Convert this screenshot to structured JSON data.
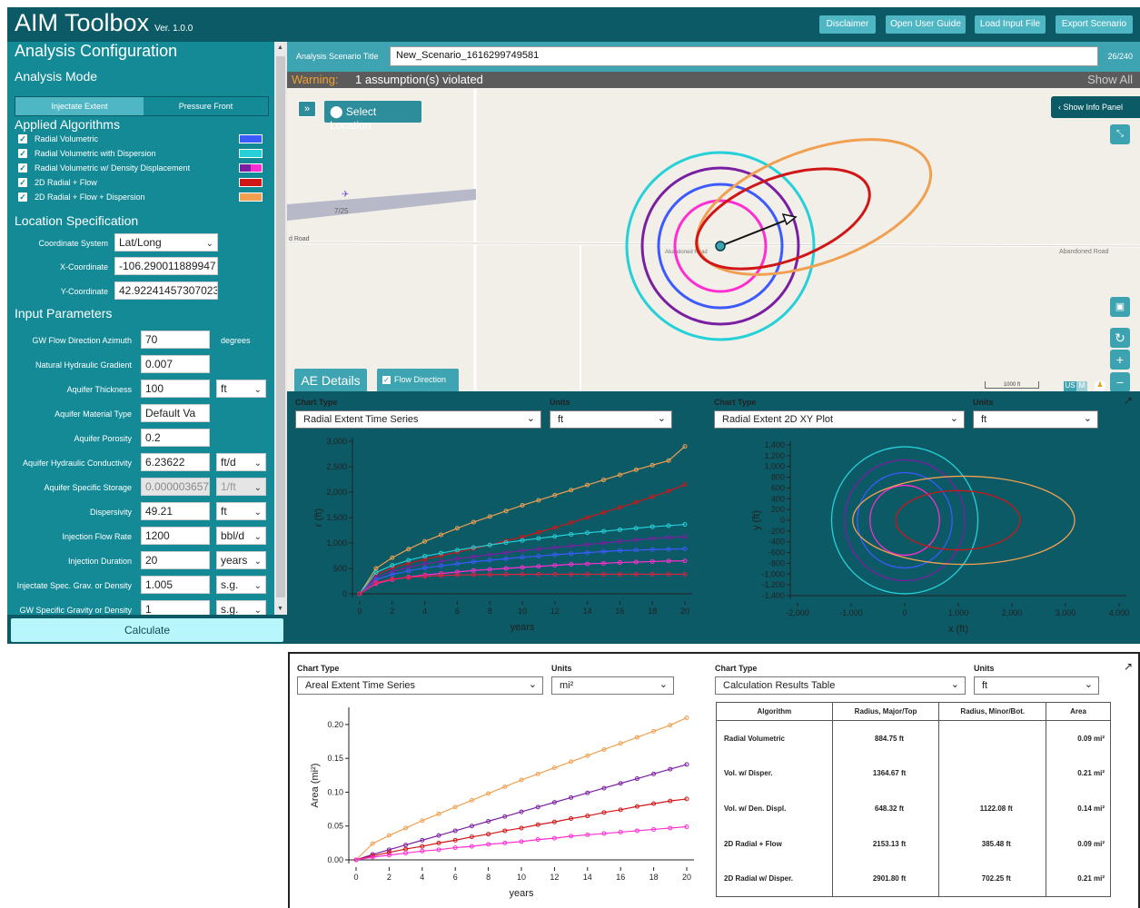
{
  "app": {
    "title": "AIM Toolbox",
    "version": "Ver. 1.0.0"
  },
  "header_buttons": [
    "Disclaimer",
    "Open User Guide",
    "Load Input File",
    "Export Scenario"
  ],
  "sidebar": {
    "section_title": "Analysis Configuration",
    "mode_title": "Analysis Mode",
    "modes": [
      "Injectate Extent",
      "Pressure Front"
    ],
    "algo_title": "Applied Algorithms",
    "algorithms": [
      {
        "label": "Radial Volumetric",
        "color": "#3d5afe"
      },
      {
        "label": "Radial Volumetric with Dispersion",
        "color": "#26d0d8"
      },
      {
        "label": "Radial Volumetric w/ Density Displacement",
        "color": "#7b1fa2",
        "color2": "#ff2ed0"
      },
      {
        "label": "2D Radial + Flow",
        "color": "#d01616"
      },
      {
        "label": "2D Radial + Flow + Dispersion",
        "color": "#f0a050"
      }
    ],
    "location_title": "Location Specification",
    "coord_system_label": "Coordinate System",
    "coord_system": "Lat/Long",
    "x_label": "X-Coordinate",
    "x_value": "-106.290011889947",
    "y_label": "Y-Coordinate",
    "y_value": "42.92241457307023",
    "input_title": "Input Parameters",
    "params": [
      {
        "label": "GW Flow Direction Azimuth",
        "value": "70",
        "unit": "degrees"
      },
      {
        "label": "Natural Hydraulic Gradient",
        "value": "0.007",
        "unit": ""
      },
      {
        "label": "Aquifer Thickness",
        "value": "100",
        "unit": "ft"
      },
      {
        "label": "Aquifer Material Type",
        "value": "Default Va",
        "unit": ""
      },
      {
        "label": "Aquifer Porosity",
        "value": "0.2",
        "unit": ""
      },
      {
        "label": "Aquifer Hydraulic Conductivity",
        "value": "6.23622",
        "unit": "ft/d"
      },
      {
        "label": "Aquifer Specific Storage",
        "value": "0.000003657",
        "unit": "1/ft"
      },
      {
        "label": "Dispersivity",
        "value": "49.21",
        "unit": "ft"
      },
      {
        "label": "Injection Flow Rate",
        "value": "1200",
        "unit": "bbl/d"
      },
      {
        "label": "Injection Duration",
        "value": "20",
        "unit": "years"
      },
      {
        "label": "Injectate Spec. Grav. or Density",
        "value": "1.005",
        "unit": "s.g."
      },
      {
        "label": "GW Specific Gravity or Density",
        "value": "1",
        "unit": "s.g."
      }
    ],
    "calculate": "Calculate"
  },
  "scenario": {
    "label": "Analysis Scenario Title",
    "title": "New_Scenario_1616299749581",
    "count": "26/240"
  },
  "warning": {
    "prefix": "Warning:",
    "text": "1 assumption(s) violated",
    "show_all": "Show All"
  },
  "map": {
    "select_location": "Select Location",
    "show_info": "Show Info Panel",
    "ae_details": "AE Details",
    "flow_direction": "Flow Direction",
    "runway": "7/25",
    "road_left": "d Road",
    "road_mid": "Abandoned Road",
    "road_right": "Abandoned Road",
    "scale": "1000 ft",
    "unit_us": "US",
    "unit_m": "M"
  },
  "panel1": {
    "chart_type_label": "Chart Type",
    "units_label": "Units",
    "chart_type": "Radial Extent Time Series",
    "units": "ft"
  },
  "panel2": {
    "chart_type_label": "Chart Type",
    "units_label": "Units",
    "chart_type": "Radial Extent 2D XY Plot",
    "units": "ft"
  },
  "panel3": {
    "chart_type_label": "Chart Type",
    "units_label": "Units",
    "chart_type": "Areal Extent Time Series",
    "units": "mi²"
  },
  "panel4": {
    "chart_type_label": "Chart Type",
    "units_label": "Units",
    "chart_type": "Calculation Results Table",
    "units": "ft"
  },
  "table": {
    "headers": [
      "Algorithm",
      "Radius, Major/Top",
      "Radius, Minor/Bot.",
      "Area"
    ],
    "rows": [
      [
        "Radial Volumetric",
        "884.75 ft",
        "",
        "0.09 mi²"
      ],
      [
        "Vol. w/ Disper.",
        "1364.67 ft",
        "",
        "0.21 mi²"
      ],
      [
        "Vol. w/ Den. Displ.",
        "648.32 ft",
        "1122.08 ft",
        "0.14 mi²"
      ],
      [
        "2D Radial + Flow",
        "2153.13 ft",
        "385.48 ft",
        "0.09 mi²"
      ],
      [
        "2D Radial w/ Disper.",
        "2901.80 ft",
        "702.25 ft",
        "0.21 mi²"
      ]
    ]
  },
  "chart_data": [
    {
      "type": "line",
      "xlabel": "years",
      "ylabel": "r (ft)",
      "xlim": [
        0,
        20
      ],
      "ylim": [
        0,
        3000
      ],
      "xticks": [
        0,
        2,
        4,
        6,
        8,
        10,
        12,
        14,
        16,
        18,
        20
      ],
      "yticks": [
        0,
        500,
        1000,
        1500,
        2000,
        2500,
        3000
      ],
      "ytick_labels": [
        "0",
        "500",
        "1,000",
        "1,500",
        "2,000",
        "2,500",
        "3,000"
      ],
      "x": [
        0,
        1,
        2,
        3,
        4,
        5,
        6,
        7,
        8,
        9,
        10,
        11,
        12,
        13,
        14,
        15,
        16,
        17,
        18,
        19,
        20
      ],
      "series": [
        {
          "color": "#f0a050",
          "values": [
            0,
            500,
            710,
            880,
            1030,
            1160,
            1290,
            1410,
            1520,
            1630,
            1740,
            1840,
            1940,
            2040,
            2140,
            2240,
            2340,
            2440,
            2530,
            2620,
            2900
          ]
        },
        {
          "color": "#d01616",
          "values": [
            0,
            380,
            510,
            600,
            680,
            750,
            820,
            890,
            960,
            1040,
            1120,
            1210,
            1300,
            1400,
            1500,
            1600,
            1700,
            1800,
            1910,
            2020,
            2150
          ]
        },
        {
          "color": "#26d0d8",
          "values": [
            0,
            420,
            560,
            660,
            740,
            800,
            860,
            910,
            960,
            1010,
            1050,
            1090,
            1130,
            1170,
            1200,
            1230,
            1260,
            1290,
            1320,
            1340,
            1365
          ]
        },
        {
          "color": "#7b1fa2",
          "values": [
            0,
            320,
            440,
            520,
            590,
            640,
            690,
            730,
            770,
            810,
            850,
            880,
            910,
            940,
            970,
            1000,
            1030,
            1060,
            1090,
            1110,
            1122
          ]
        },
        {
          "color": "#3d5afe",
          "values": [
            0,
            280,
            380,
            450,
            510,
            550,
            590,
            630,
            660,
            690,
            720,
            740,
            770,
            790,
            810,
            830,
            850,
            860,
            870,
            880,
            885
          ]
        },
        {
          "color": "#ff2ed0",
          "values": [
            0,
            200,
            280,
            330,
            370,
            400,
            430,
            460,
            480,
            500,
            520,
            540,
            560,
            580,
            590,
            600,
            615,
            625,
            635,
            645,
            648
          ]
        },
        {
          "color": "#e02040",
          "values": [
            0,
            220,
            290,
            320,
            345,
            360,
            370,
            375,
            380,
            382,
            384,
            385,
            385,
            385,
            385,
            385,
            385,
            385,
            385,
            385,
            385
          ]
        }
      ]
    },
    {
      "type": "line",
      "xlabel": "x (ft)",
      "ylabel": "y (ft)",
      "xlim": [
        -2000,
        4000
      ],
      "ylim": [
        -1400,
        1400
      ],
      "xticks": [
        -2000,
        -1000,
        0,
        1000,
        2000,
        3000,
        4000
      ],
      "xtick_labels": [
        "-2,000",
        "-1,000",
        "0",
        "1,000",
        "2,000",
        "3,000",
        "4,000"
      ],
      "yticks": [
        1400,
        1200,
        1000,
        800,
        600,
        400,
        200,
        0,
        -200,
        -400,
        -600,
        -800,
        -1000,
        -1200,
        -1400
      ],
      "ytick_labels": [
        "1,400",
        "1,200",
        "1,000",
        "800",
        "600",
        "400",
        "200",
        "0",
        "-200",
        "-400",
        "-600",
        "-800",
        "-1,000",
        "-1,200",
        "-1,400"
      ],
      "circles": [
        {
          "color": "#26d0d8",
          "r": 1365
        },
        {
          "color": "#7b1fa2",
          "r": 1122
        },
        {
          "color": "#3d5afe",
          "r": 885
        },
        {
          "color": "#ff2ed0",
          "r": 648
        }
      ],
      "ellipses": [
        {
          "color": "#f0a050",
          "cx": 1100,
          "rx": 2900,
          "ry": 700
        },
        {
          "color": "#d01616",
          "cx": 990,
          "rx": 2150,
          "ry": 470
        }
      ]
    },
    {
      "type": "line",
      "xlabel": "years",
      "ylabel": "Area (mi²)",
      "xlim": [
        0,
        20
      ],
      "ylim": [
        0,
        0.22
      ],
      "xticks": [
        0,
        2,
        4,
        6,
        8,
        10,
        12,
        14,
        16,
        18,
        20
      ],
      "yticks": [
        0,
        0.05,
        0.1,
        0.15,
        0.2
      ],
      "ytick_labels": [
        "0.00",
        "0.05",
        "0.10",
        "0.15",
        "0.20"
      ],
      "x": [
        0,
        1,
        2,
        3,
        4,
        5,
        6,
        7,
        8,
        9,
        10,
        11,
        12,
        13,
        14,
        15,
        16,
        17,
        18,
        19,
        20
      ],
      "series": [
        {
          "color": "#f0a050",
          "values": [
            0,
            0.024,
            0.036,
            0.047,
            0.058,
            0.068,
            0.078,
            0.088,
            0.098,
            0.108,
            0.118,
            0.127,
            0.136,
            0.145,
            0.154,
            0.163,
            0.172,
            0.181,
            0.19,
            0.199,
            0.21
          ]
        },
        {
          "color": "#7b1fa2",
          "values": [
            0,
            0.008,
            0.015,
            0.022,
            0.029,
            0.036,
            0.043,
            0.05,
            0.057,
            0.064,
            0.071,
            0.078,
            0.085,
            0.092,
            0.099,
            0.106,
            0.113,
            0.12,
            0.127,
            0.134,
            0.141
          ]
        },
        {
          "color": "#d01616",
          "values": [
            0,
            0.006,
            0.011,
            0.016,
            0.02,
            0.025,
            0.029,
            0.034,
            0.038,
            0.043,
            0.047,
            0.052,
            0.056,
            0.061,
            0.065,
            0.07,
            0.074,
            0.079,
            0.083,
            0.087,
            0.09
          ]
        },
        {
          "color": "#ff2ed0",
          "values": [
            0,
            0.004,
            0.007,
            0.01,
            0.013,
            0.015,
            0.018,
            0.02,
            0.023,
            0.025,
            0.027,
            0.03,
            0.032,
            0.035,
            0.037,
            0.039,
            0.041,
            0.043,
            0.045,
            0.047,
            0.049
          ]
        }
      ]
    }
  ]
}
